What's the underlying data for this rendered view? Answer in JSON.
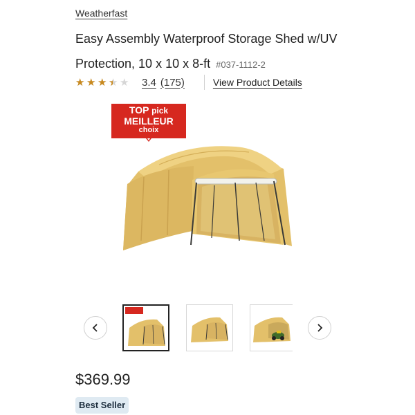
{
  "product": {
    "brand": "Weatherfast",
    "title_line1": "Easy Assembly Waterproof Storage Shed w/UV",
    "title_line2": "Protection, 10 x 10 x 8-ft",
    "sku": "#037-1112-2",
    "rating_value": "3.4",
    "rating": 3.4,
    "rating_max": 5,
    "review_count": "(175)",
    "details_link": "View Product Details",
    "price": "$369.99",
    "badge": "Best Seller"
  },
  "promo_badge": {
    "line1_bold": "TOP",
    "line1_rest": "pick",
    "line2": "MEILLEUR",
    "line3": "choix",
    "color": "#d6281f"
  },
  "icons": {
    "star": "star-icon",
    "prev": "chevron-left-icon",
    "next": "chevron-right-icon"
  },
  "colors": {
    "star_filled": "#c8891e",
    "star_empty": "#d6d6d6",
    "tent_canvas": "#e5c36f",
    "best_seller_bg": "#dfeaf2"
  },
  "gallery": {
    "thumbnail_count": 3,
    "active_index": 0
  }
}
